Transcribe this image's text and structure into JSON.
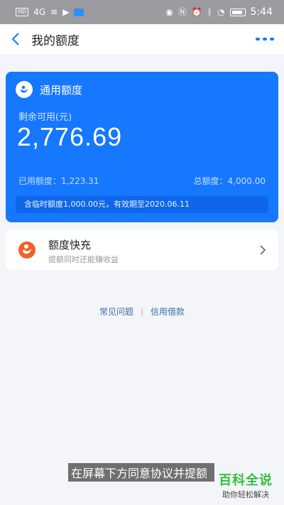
{
  "status_bar": {
    "left_badge": "HD",
    "signal": "4G",
    "time": "5:44"
  },
  "nav": {
    "title": "我的额度"
  },
  "quota_card": {
    "title": "通用额度",
    "remaining_label": "剩余可用(元)",
    "remaining_amount": "2,776.69",
    "used": "已用额度：1,223.31",
    "total": "总额度：4,000.00",
    "temp_notice": "含临时额度1,000.00元，有效期至2020.06.11",
    "color": "#1677ff"
  },
  "quick_recharge": {
    "title": "额度快充",
    "subtitle": "提额同时还能赚收益",
    "icon_color": "#f0612b"
  },
  "links": {
    "faq": "常见问题",
    "separator": "|",
    "credit_loan": "信用借款"
  },
  "overlay": {
    "subtitle": "在屏幕下方同意协议并提额",
    "watermark_title": "百科全说",
    "watermark_sub": "助你轻松解决"
  }
}
